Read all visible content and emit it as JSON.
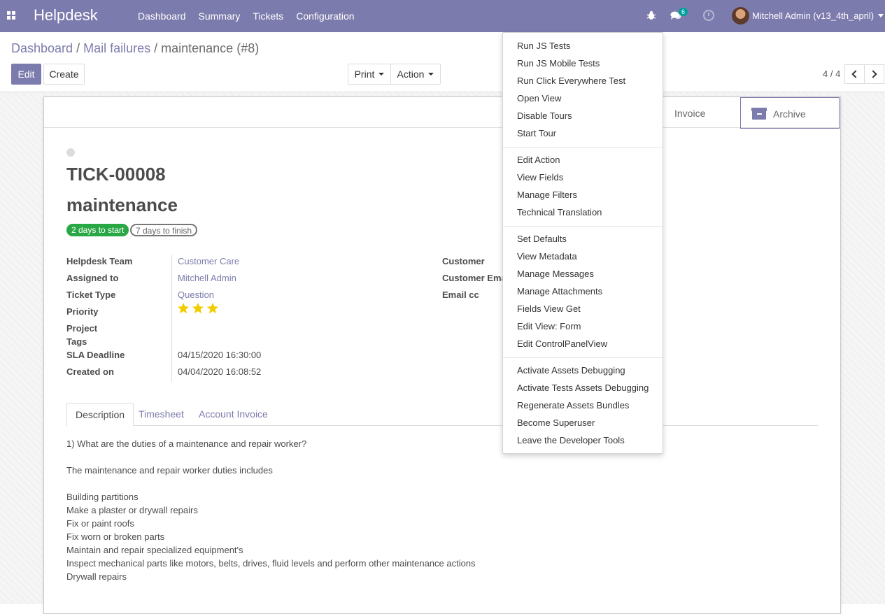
{
  "navbar": {
    "brand": "Helpdesk",
    "menu": [
      "Dashboard",
      "Summary",
      "Tickets",
      "Configuration"
    ],
    "messages_count": "6",
    "user": "Mitchell Admin (v13_4th_april)",
    "accent_color": "#7c7bad"
  },
  "breadcrumb": {
    "items": [
      "Dashboard",
      "Mail failures"
    ],
    "current": "maintenance (#8)"
  },
  "controls": {
    "edit": "Edit",
    "create": "Create",
    "print": "Print",
    "action": "Action",
    "pager": "4 / 4"
  },
  "smart_buttons": {
    "invoice": "Invoice",
    "archive": "Archive"
  },
  "ticket": {
    "ref": "TICK-00008",
    "name": "maintenance",
    "badge_start": "2 days to start",
    "badge_finish": "7 days to finish",
    "left_fields": [
      {
        "label": "Helpdesk Team",
        "value": "Customer Care"
      },
      {
        "label": "Assigned to",
        "value": "Mitchell Admin"
      },
      {
        "label": "Ticket Type",
        "value": "Question"
      },
      {
        "label": "Priority",
        "value": ""
      },
      {
        "label": "Project",
        "value": ""
      },
      {
        "label": "Tags",
        "value": ""
      },
      {
        "label": "SLA Deadline",
        "value": "04/15/2020 16:30:00"
      },
      {
        "label": "Created on",
        "value": "04/04/2020 16:08:52"
      }
    ],
    "priority_stars": 3,
    "right_fields": [
      {
        "label": "Customer"
      },
      {
        "label": "Customer Ema"
      },
      {
        "label": "Email cc"
      }
    ]
  },
  "tabs": [
    "Description",
    "Timesheet",
    "Account Invoice"
  ],
  "description": [
    "1) What are the duties of a maintenance and repair worker?",
    "",
    "The maintenance and repair worker duties includes",
    "",
    "Building partitions",
    "Make a plaster or drywall repairs",
    "Fix or paint roofs",
    "Fix worn or broken parts",
    "Maintain and repair specialized equipment's",
    "Inspect mechanical parts like motors, belts, drives, fluid levels and perform other maintenance actions",
    "Drywall repairs"
  ],
  "debug_menu": {
    "group1": [
      "Run JS Tests",
      "Run JS Mobile Tests",
      "Run Click Everywhere Test",
      "Open View",
      "Disable Tours",
      "Start Tour"
    ],
    "group2": [
      "Edit Action",
      "View Fields",
      "Manage Filters",
      "Technical Translation"
    ],
    "group3": [
      "Set Defaults",
      "View Metadata",
      "Manage Messages",
      "Manage Attachments",
      "Fields View Get",
      "Edit View: Form",
      "Edit ControlPanelView"
    ],
    "group4": [
      "Activate Assets Debugging",
      "Activate Tests Assets Debugging",
      "Regenerate Assets Bundles",
      "Become Superuser",
      "Leave the Developer Tools"
    ]
  }
}
